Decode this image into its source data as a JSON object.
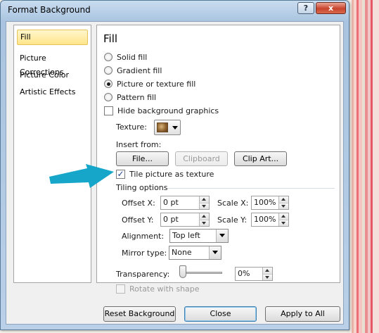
{
  "window": {
    "title": "Format Background",
    "help_label": "?",
    "close_label": "x"
  },
  "nav": {
    "items": [
      {
        "label": "Fill",
        "active": true
      },
      {
        "label": "Picture Corrections",
        "active": false
      },
      {
        "label": "Picture Color",
        "active": false
      },
      {
        "label": "Artistic Effects",
        "active": false
      }
    ]
  },
  "fill": {
    "heading": "Fill",
    "options": [
      {
        "label": "Solid fill",
        "checked": false
      },
      {
        "label": "Gradient fill",
        "checked": false
      },
      {
        "label": "Picture or texture fill",
        "checked": true
      },
      {
        "label": "Pattern fill",
        "checked": false
      }
    ],
    "hide_background_graphics": {
      "label": "Hide background graphics",
      "checked": false
    },
    "texture_label": "Texture:",
    "insert_from_label": "Insert from:",
    "buttons": {
      "file": "File...",
      "clipboard": "Clipboard",
      "clip_art": "Clip Art..."
    },
    "tile_as_texture": {
      "label": "Tile picture as texture",
      "checked": true
    },
    "tiling_options_label": "Tiling options",
    "offset_x": {
      "label": "Offset X:",
      "value": "0 pt"
    },
    "offset_y": {
      "label": "Offset Y:",
      "value": "0 pt"
    },
    "scale_x": {
      "label": "Scale X:",
      "value": "100%"
    },
    "scale_y": {
      "label": "Scale Y:",
      "value": "100%"
    },
    "alignment": {
      "label": "Alignment:",
      "value": "Top left"
    },
    "mirror_type": {
      "label": "Mirror type:",
      "value": "None"
    },
    "transparency": {
      "label": "Transparency:",
      "value": "0%",
      "level": 0
    },
    "rotate_with_shape": {
      "label": "Rotate with shape",
      "checked": false,
      "enabled": false
    }
  },
  "footer": {
    "reset_background": "Reset Background",
    "close": "Close",
    "apply_to_all": "Apply to All"
  },
  "colors": {
    "arrow": "#15a6c9",
    "accent": "#3c7fb1"
  }
}
